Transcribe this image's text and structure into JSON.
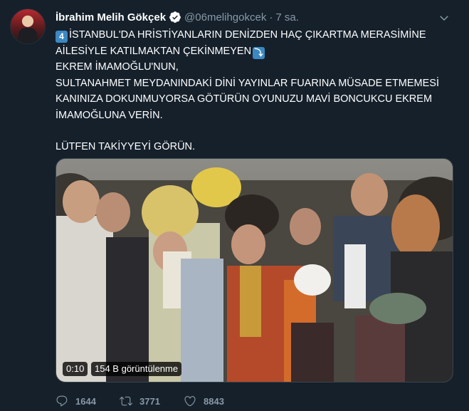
{
  "author": {
    "name": "İbrahim Melih Gökçek",
    "handle": "@06melihgokcek",
    "separator": "·",
    "time": "7 sa."
  },
  "tweet": {
    "line1_emoji": "4",
    "line1": "İSTANBUL'DA HRİSTİYANLARIN DENİZDEN HAÇ ÇIKARTMA MERASİMİNE",
    "line2": "AİLESİYLE KATILMAKTAN ÇEKİNMEYEN",
    "line2_emoji": "⤵",
    "line3": "EKREM İMAMOĞLU'NUN,",
    "line4": "SULTANAHMET MEYDANINDAKİ DİNİ YAYINLAR FUARINA MÜSADE ETMEMESİ",
    "line5": "KANINIZA DOKUNMUYORSA GÖTÜRÜN OYUNUZU MAVİ BONCUKCU EKREM",
    "line6": "İMAMOĞLUNA VERİN.",
    "line7": "LÜTFEN TAKİYYEYİ GÖRÜN."
  },
  "video": {
    "duration": "0:10",
    "views": "154 B görüntülenme"
  },
  "stats": {
    "replies": "1644",
    "retweets": "3771",
    "likes": "8843"
  },
  "colors": {
    "background": "#15202b",
    "secondary_text": "#8899a6",
    "verified": "#1da1f2",
    "emoji_keycap": "#3b88c3"
  },
  "icons": [
    "verified-badge-icon",
    "chevron-down-icon",
    "reply-icon",
    "retweet-icon",
    "like-icon"
  ]
}
